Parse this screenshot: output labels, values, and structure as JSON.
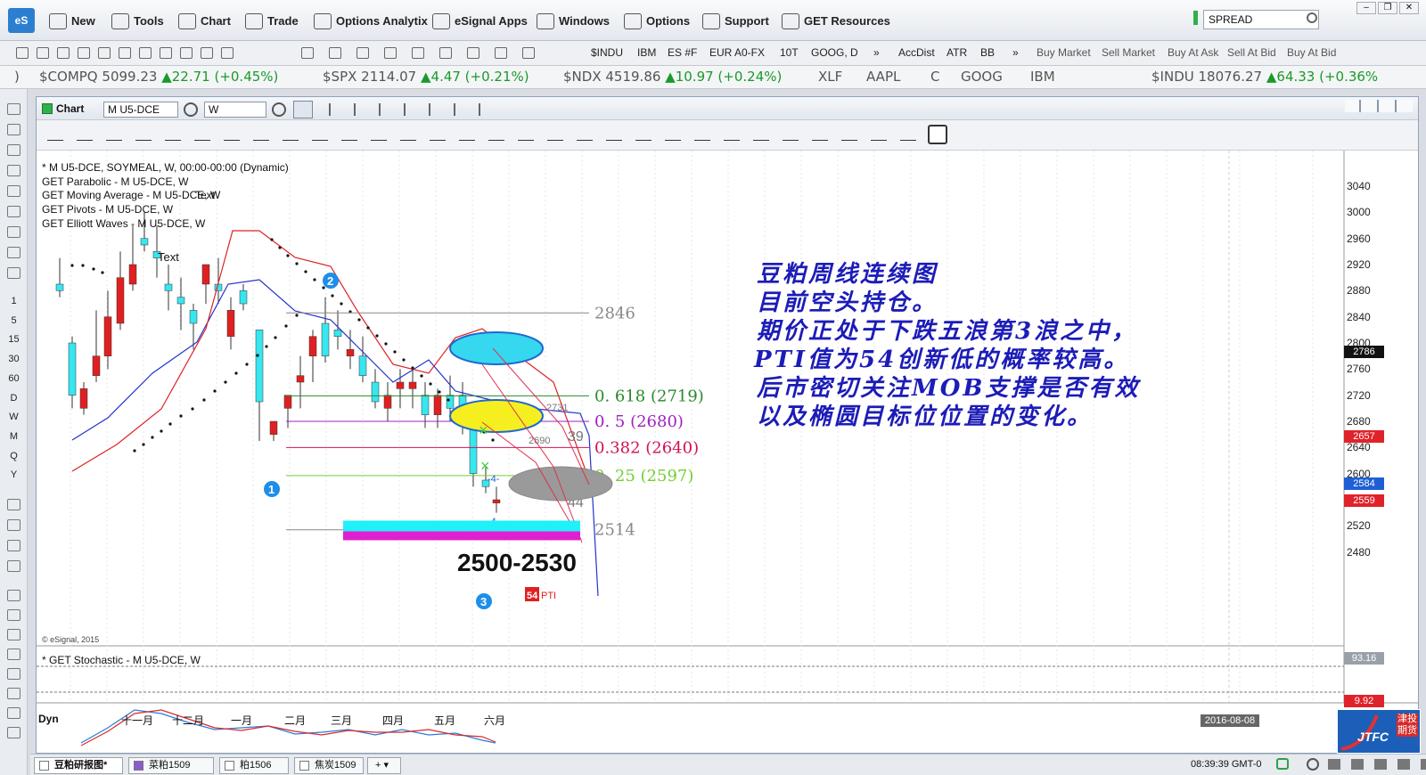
{
  "app": {
    "logo": "eS"
  },
  "menu": [
    {
      "label": "New",
      "icon": "new-icon"
    },
    {
      "label": "Tools",
      "icon": "tools-icon"
    },
    {
      "label": "Chart",
      "icon": "chart-icon"
    },
    {
      "label": "Trade",
      "icon": "trade-icon"
    },
    {
      "label": "Options Analytix",
      "icon": "options-analytix-icon"
    },
    {
      "label": "eSignal Apps",
      "icon": "apps-icon"
    },
    {
      "label": "Windows",
      "icon": "windows-icon"
    },
    {
      "label": "Options",
      "icon": "gear-icon"
    },
    {
      "label": "Support",
      "icon": "help-icon"
    },
    {
      "label": "GET Resources",
      "icon": "get-icon"
    }
  ],
  "search": {
    "value": "SPREAD"
  },
  "toolbar2": {
    "symbols": [
      "$INDU",
      "IBM",
      "ES #F",
      "EUR A0-FX",
      "10T",
      "GOOG, D",
      "»",
      "AccDist",
      "ATR",
      "BB",
      "»",
      "Buy Market",
      "Sell Market",
      "Buy At Ask",
      "Sell At Bid",
      "Buy At Bid"
    ]
  },
  "ticker": [
    {
      "sym": "$COMPQ",
      "price": "5099.23",
      "chg": "▲22.71 (+0.45%)"
    },
    {
      "sym": "$SPX",
      "price": "2114.07",
      "chg": "▲4.47 (+0.21%)"
    },
    {
      "sym": "$NDX",
      "price": "4519.86",
      "chg": "▲10.97 (+0.24%)"
    },
    {
      "sym": "XLF",
      "price": "",
      "chg": ""
    },
    {
      "sym": "AAPL",
      "price": "",
      "chg": ""
    },
    {
      "sym": "C",
      "price": "",
      "chg": ""
    },
    {
      "sym": "GOOG",
      "price": "",
      "chg": ""
    },
    {
      "sym": "IBM",
      "price": "",
      "chg": ""
    },
    {
      "sym": "$INDU",
      "price": "18076.27",
      "chg": "▲64.33 (+0.36%"
    }
  ],
  "left_intervals": [
    "1",
    "5",
    "15",
    "30",
    "60",
    "D",
    "W",
    "M",
    "Q",
    "Y"
  ],
  "chart": {
    "title": "Chart",
    "symbol": "M U5-DCE",
    "interval": "W",
    "legend": [
      "* M U5-DCE, SOYMEAL, W, 00:00-00:00 (Dynamic)",
      "GET Parabolic - M U5-DCE, W",
      "GET Moving Average - M U5-DCE, W",
      "GET Pivots - M U5-DCE, W",
      "GET Elliott Waves - M U5-DCE, W"
    ],
    "text_tool": "Text",
    "text_tool2": "Text",
    "copyright": "© eSignal, 2015",
    "stoch_legend": "* GET Stochastic - M U5-DCE, W",
    "dyn": "Dyn",
    "x_labels": [
      "十一月",
      "十二月",
      "一月",
      "二月",
      "三月",
      "四月",
      "五月",
      "六月"
    ],
    "y_labels": [
      "3040",
      "3000",
      "2960",
      "2920",
      "2880",
      "2840",
      "2800",
      "2760",
      "2720",
      "2680",
      "2640",
      "2600",
      "2560",
      "2520",
      "2480"
    ],
    "price_tags": [
      {
        "v": "2786",
        "c": "#111"
      },
      {
        "v": "2657",
        "c": "#e0222a"
      },
      {
        "v": "2584",
        "c": "#1f5fd6"
      },
      {
        "v": "2559",
        "c": "#e0222a"
      }
    ],
    "stoch_tags": [
      {
        "v": "93.16",
        "c": "#9aa0a8"
      },
      {
        "v": "9.92",
        "c": "#e0222a"
      }
    ],
    "date_label": "2016-08-08",
    "levels": [
      {
        "label": "2846",
        "price": 2846
      },
      {
        "label": "0. 618  (2719)",
        "price": 2719
      },
      {
        "label": "0. 5  (2680)",
        "price": 2680
      },
      {
        "label": "0.382  (2640)",
        "price": 2640
      },
      {
        "label": "0. 25  (2597)",
        "price": 2597
      },
      {
        "label": "2514",
        "price": 2514
      }
    ],
    "small_labels": [
      "2731",
      "2690",
      "39",
      "44",
      "-4-",
      "-4-"
    ],
    "target_text": "2500-2530",
    "waves": [
      "1",
      "2",
      "3"
    ],
    "pti": "54",
    "pti_label": "PTI"
  },
  "annotation": [
    "豆粕周线连续图",
    "目前空头持仓。",
    "期价正处于下跌五浪第3浪之中，",
    "PTI值为54创新低的概率较高。",
    "后市密切关注MOB支撑是否有效",
    "以及椭圆目标位位置的变化。"
  ],
  "bottom_tabs": [
    "豆粕研报图*",
    "菜粕1509",
    "粕1506",
    "焦炭1509"
  ],
  "status": {
    "time": "08:39:39 GMT-0",
    "brand": "JTFC",
    "brand_cn": "津投期货"
  },
  "chart_data": {
    "type": "candlestick",
    "x": [
      "十一月",
      "十二月",
      "一月",
      "二月",
      "三月",
      "四月",
      "五月",
      "六月"
    ],
    "ylim": [
      2460,
      3050
    ],
    "levels": [
      2846,
      2719,
      2680,
      2640,
      2597,
      2514
    ],
    "last": 2559,
    "target_range": [
      2500,
      2530
    ]
  }
}
